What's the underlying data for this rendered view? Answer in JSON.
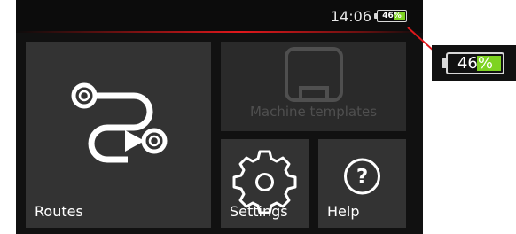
{
  "status": {
    "time": "14:06",
    "battery_text": "46%",
    "battery_level": 0.46,
    "separator_color": "#e0181c",
    "battery_fill_color": "#7ed321"
  },
  "tiles": {
    "routes": {
      "label": "Routes",
      "icon": "routes-icon"
    },
    "machine_templates": {
      "label": "Machine templates",
      "icon": "machine-template-icon",
      "disabled": true
    },
    "settings": {
      "label": "Settings",
      "icon": "gear-icon"
    },
    "help": {
      "label": "Help",
      "icon": "question-icon"
    }
  },
  "callout": {
    "battery_text": "46%"
  }
}
